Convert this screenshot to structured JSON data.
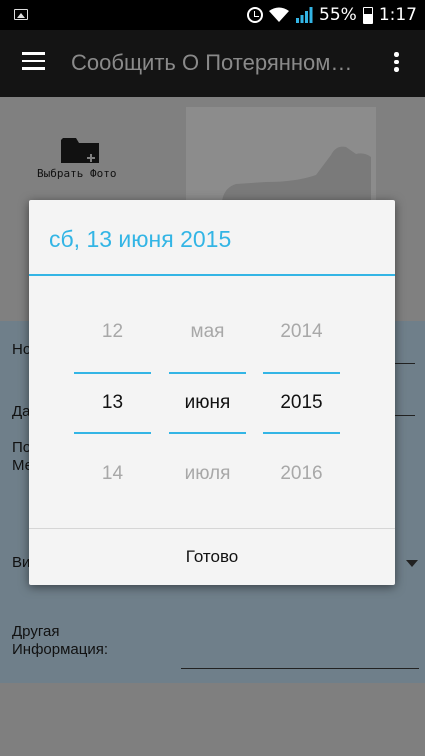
{
  "status_bar": {
    "battery_percent": "55%",
    "time": "1:17",
    "icons": [
      "image-icon",
      "alarm-icon",
      "wifi-icon",
      "signal-icon",
      "battery-icon"
    ]
  },
  "app_bar": {
    "title": "Сообщить О Потерянном…",
    "icons": [
      "menu-icon",
      "overflow-menu-icon"
    ]
  },
  "photo_section": {
    "choose_photo_label": "Выбрать Фото",
    "icons": [
      "folder-add-icon",
      "dog-placeholder-icon"
    ]
  },
  "form": {
    "name_label": "Но",
    "date_label": "Да",
    "place_label_line1": "По",
    "place_label_line2": "Ме",
    "type_label": "Ви",
    "other_info_label_line1": "Другая",
    "other_info_label_line2": "Информация:"
  },
  "date_dialog": {
    "title": "сб, 13 июня 2015",
    "day": {
      "prev": "12",
      "current": "13",
      "next": "14"
    },
    "month": {
      "prev": "мая",
      "current": "июня",
      "next": "июля"
    },
    "year": {
      "prev": "2014",
      "current": "2015",
      "next": "2016"
    },
    "done_label": "Готово"
  },
  "colors": {
    "accent": "#33b5e5",
    "app_bar": "#141414",
    "dim_overlay_background": "#7f7f7f",
    "form_background": "#6f7f8a",
    "dialog_background": "#f4f4f4"
  }
}
